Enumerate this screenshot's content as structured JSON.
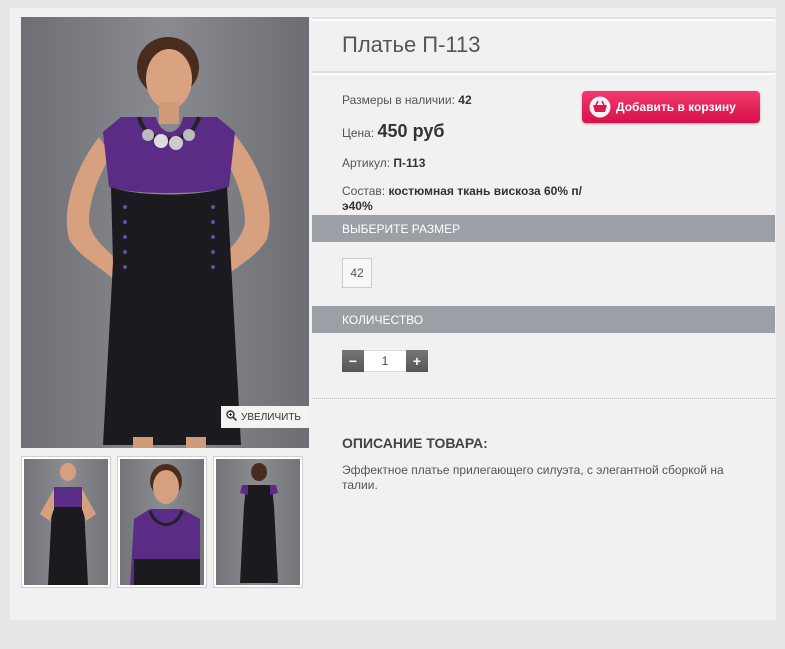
{
  "product": {
    "title": "Платье П-113",
    "sizes_label": "Размеры в наличии:",
    "sizes_value": "42",
    "price_label": "Цена:",
    "price_value": "450 руб",
    "article_label": "Артикул:",
    "article_value": "П-113",
    "composition_label": "Состав:",
    "composition_value": "костюмная ткань вискоза 60% п/э40%"
  },
  "cart": {
    "button_label": "Добавить в корзину",
    "accent": "#e0174f"
  },
  "gallery": {
    "zoom_label": "УВЕЛИЧИТЬ"
  },
  "size_section": {
    "header": "ВЫБЕРИТЕ РАЗМЕР",
    "options": [
      "42"
    ]
  },
  "quantity_section": {
    "header": "КОЛИЧЕСТВО",
    "minus": "−",
    "value": "1",
    "plus": "+"
  },
  "description": {
    "header": "ОПИСАНИЕ ТОВАРА:",
    "text": "Эффектное платье прилегающего силуэта, с элегантной сборкой на талии."
  }
}
